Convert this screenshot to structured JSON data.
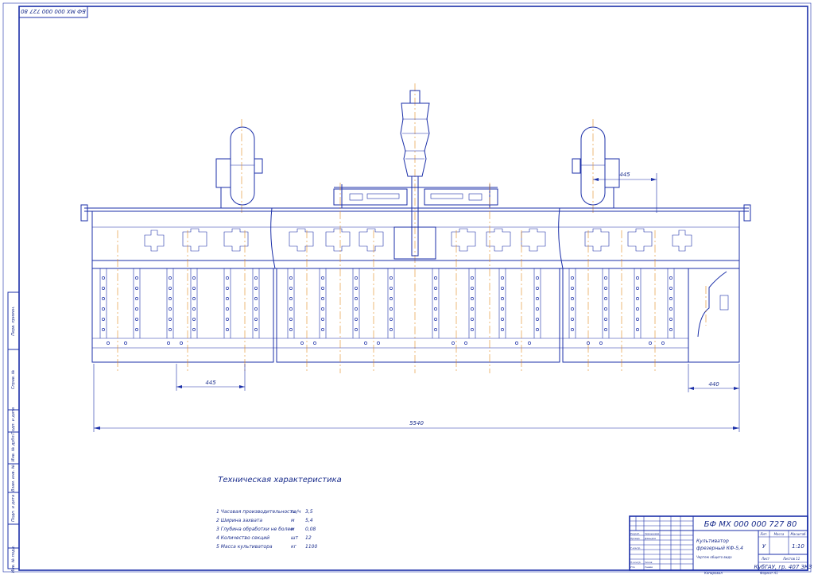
{
  "stamp_code_top": "БФ МХ 000 000 727 80",
  "dimensions": {
    "overall_width": "5540",
    "section_pitch": "445",
    "wheel_offset": "445",
    "side_plate": "440"
  },
  "tech_title": "Техническая характеристика",
  "specs": [
    {
      "name": "1 Часовая производительность",
      "unit": "га/ч",
      "value": "3,5"
    },
    {
      "name": "2 Ширина захвата",
      "unit": "м",
      "value": "5,4"
    },
    {
      "name": "3 Глубина обработки не более",
      "unit": "м",
      "value": "0,08"
    },
    {
      "name": "4 Количество секций",
      "unit": "шт",
      "value": "12"
    },
    {
      "name": "5 Масса культиватора",
      "unit": "кг",
      "value": "1100"
    }
  ],
  "title_block": {
    "code": "БФ МХ 000 000 727 80",
    "name_line1": "Культиватор",
    "name_line2": "фрезерный КФ-5,4",
    "name_line3": "Чертеж общего вида",
    "scale": "1:10",
    "letter": "У",
    "org": "КубГАУ, гр. 407 ЗКЗ",
    "roles": [
      "Изм",
      "Лист",
      "№ докум.",
      "Подп.",
      "Дата",
      "Разраб.",
      "Провер.",
      "Т.контр.",
      "Н.контр.",
      "Утв."
    ],
    "names": [
      "Чернышева",
      "Давыдов",
      "",
      "Чиков",
      "Ушеев"
    ],
    "col_labels": [
      "Лит.",
      "Масса",
      "Масштаб"
    ],
    "sheet": "Лист",
    "sheets": "Листов 11",
    "copied": "Копировал",
    "format": "Формат А1"
  },
  "side_strip": [
    "Перв. примен.",
    "Справ. №",
    "Подп. и дата",
    "Инв. № дубл.",
    "Взам. инв. №",
    "Подп. и дата",
    "Инв. № подл."
  ]
}
